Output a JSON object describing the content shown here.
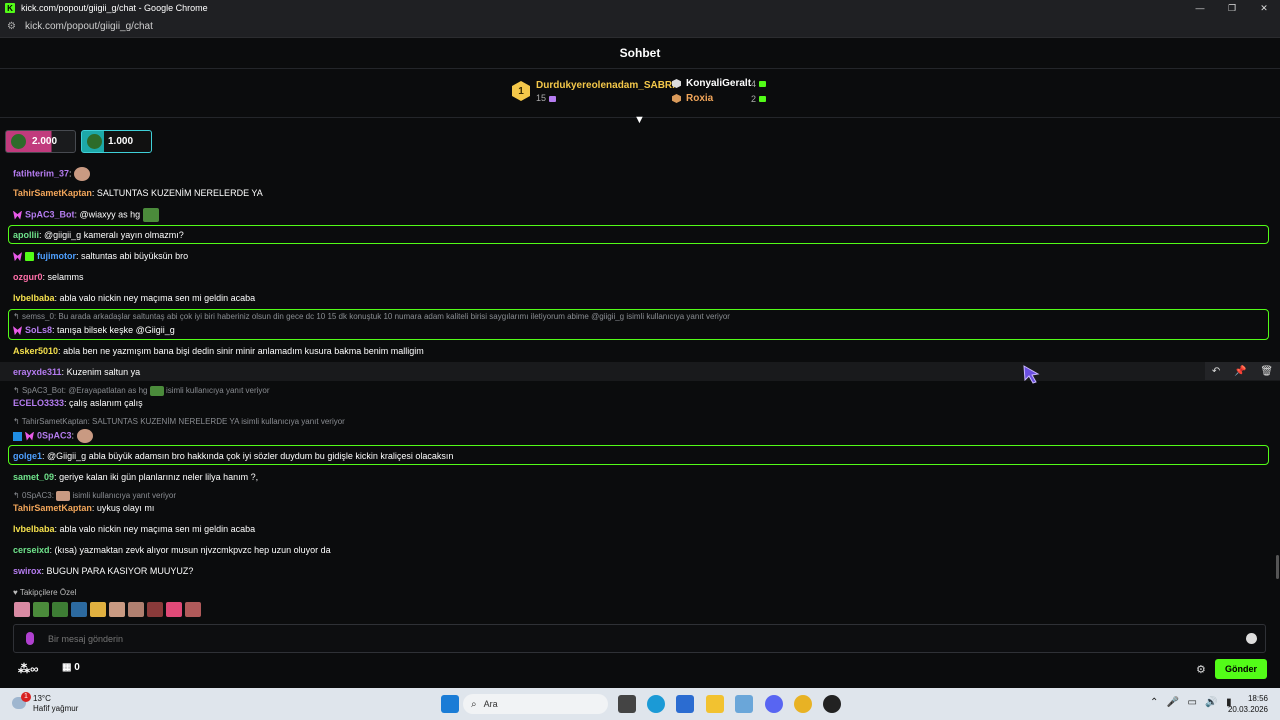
{
  "browser": {
    "window_title": "kick.com/popout/giigii_g/chat - Google Chrome",
    "url": "kick.com/popout/giigii_g/chat"
  },
  "chat": {
    "title": "Sohbet",
    "leaderboard": {
      "first": {
        "rank": "1",
        "name": "Durdukyereolenadam_SABRI",
        "count": "15"
      },
      "others": [
        {
          "name": "KonyaliGeralt",
          "count": "4"
        },
        {
          "name": "Roxia",
          "count": "2"
        }
      ]
    },
    "goals": [
      {
        "value": "2.000"
      },
      {
        "value": "1.000"
      }
    ],
    "messages": [
      {
        "user": "fatihterim_37",
        "text": ""
      },
      {
        "user": "TahirSametKaptan",
        "text": "SALTUNTAS KUZENİM NERELERDE YA"
      },
      {
        "user": "SpAC3_Bot",
        "text": "@wiaxyy as hg"
      },
      {
        "user": "apollii",
        "text": "@giigii_g kameralı yayın olmazmı?"
      },
      {
        "user": "fujimotor",
        "text": "saltuntas abi büyüksün bro"
      },
      {
        "user": "ozgur0",
        "text": "selamms"
      },
      {
        "user": "lvbelbaba",
        "text": "abla valo nickin ney maçıma sen mi geldin acaba"
      },
      {
        "reply": "semss_0: Bu arada arkadaşlar saltuntaş abi çok iyi biri haberiniz olsun din gece dc 10 15 dk konuştuk 10 numara adam kaliteli birisi saygılarımı iletiyorum abime @giigii_g isimli kullanıcıya yanıt veriyor",
        "user": "SoLs8",
        "text": "tanışa bilsek keşke @Giigii_g"
      },
      {
        "user": "Asker5010",
        "text": "abla ben ne yazmışım bana bişi dedin sinir minir anlamadım kusura bakma benim malligim"
      },
      {
        "user": "erayxde311",
        "text": "Kuzenim saltun ya"
      },
      {
        "reply_prefix": "SpAC3_Bot: @Erayapatlatan as hg",
        "reply_suffix": "isimli kullanıcıya yanıt veriyor",
        "user": "ECELO3333",
        "text": "çalış aslanım çalış"
      },
      {
        "reply": "TahirSametKaptan: SALTUNTAS KUZENİM NERELERDE YA isimli kullanıcıya yanıt veriyor",
        "user": "0SpAC3",
        "text": ""
      },
      {
        "user": "golge1",
        "text": "@Giigii_g abla büyük adamsın bro hakkında çok iyi sözler duydum bu gidişle kickin kraliçesi olacaksın"
      },
      {
        "user": "samet_09",
        "text": "geriye kalan iki gün planlarınız neler lilya hanım ?,"
      },
      {
        "reply_prefix": "0SpAC3:",
        "reply_suffix": "isimli kullanıcıya yanıt veriyor",
        "user": "TahirSametKaptan",
        "text": "uykuş olayı mı"
      },
      {
        "user": "lvbelbaba",
        "text": "abla valo nickin ney maçıma sen mi geldin acaba"
      },
      {
        "user": "cerseixd",
        "text": "(kısa) yazmaktan zevk alıyor musun njvzcmkpvzc hep uzun oluyor da"
      },
      {
        "user": "swirox",
        "text": "BUGUN PARA KASIYOR MUUYUZ?"
      }
    ],
    "colors": {
      "accent": "#53fc18",
      "purple": "#b57cf0",
      "orange": "#f2a65a",
      "green": "#6fe38b",
      "yellow": "#f4e04d",
      "pink": "#ff6fa8",
      "blue": "#4ea0ff"
    },
    "followers_only_label": "Takipçilere Özel",
    "input_placeholder": "Bir mesaj gönderin",
    "infinity": "∞",
    "store_count": "0",
    "send_label": "Gönder"
  },
  "taskbar": {
    "temperature": "13°C",
    "weather": "Hafif yağmur",
    "weather_badge": "1",
    "search_placeholder": "Ara",
    "time": "18:56",
    "date": "20.03.2026"
  }
}
